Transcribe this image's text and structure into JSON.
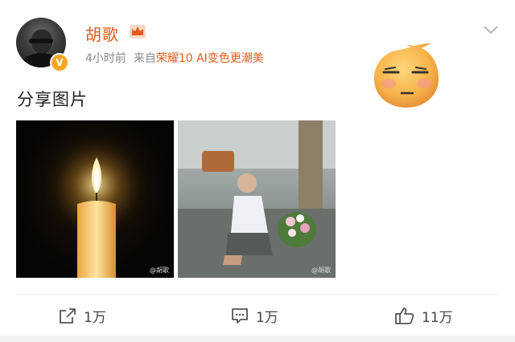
{
  "post": {
    "username": "胡歌",
    "time": "4小时前",
    "source_prefix": "来自",
    "source": "荣耀10 AI变色更潮美",
    "text": "分享图片",
    "verified_badge": "V",
    "images": [
      {
        "name": "candle-image",
        "watermark": "@胡歌"
      },
      {
        "name": "memorial-image",
        "watermark": "@胡歌"
      }
    ]
  },
  "actions": {
    "share_count": "1万",
    "comment_count": "1万",
    "like_count": "11万"
  },
  "icons": {
    "crown": "crown-icon",
    "more": "chevron-down-icon",
    "share": "share-icon",
    "comment": "comment-icon",
    "like": "thumbs-up-icon",
    "emoji": "smirk-emoji"
  },
  "colors": {
    "username": "#e35a1c",
    "meta": "#8a8a8a",
    "vip": "#f5a623"
  }
}
